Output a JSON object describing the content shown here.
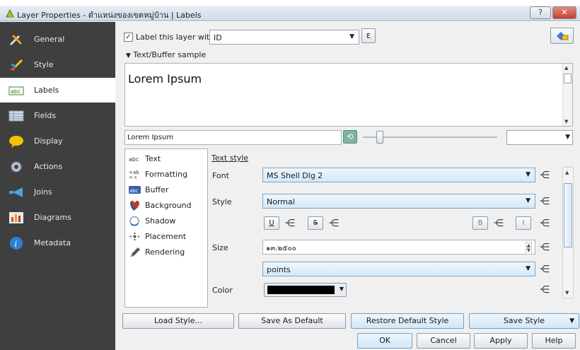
{
  "window": {
    "title": "Layer Properties - ตำแหน่งของเขตหมู่บ้าน | Labels",
    "help_label": "?",
    "close_label": "✕"
  },
  "sidebar": {
    "items": [
      {
        "label": "General",
        "icon": "tools-icon"
      },
      {
        "label": "Style",
        "icon": "paintbrush-icon"
      },
      {
        "label": "Labels",
        "icon": "abc-label-icon"
      },
      {
        "label": "Fields",
        "icon": "table-icon"
      },
      {
        "label": "Display",
        "icon": "speech-bubble-icon"
      },
      {
        "label": "Actions",
        "icon": "gear-icon"
      },
      {
        "label": "Joins",
        "icon": "join-arrow-icon"
      },
      {
        "label": "Diagrams",
        "icon": "diagram-icon"
      },
      {
        "label": "Metadata",
        "icon": "info-icon"
      }
    ],
    "active_index": 2
  },
  "labels_panel": {
    "label_with_text": "Label this layer with",
    "label_checked": true,
    "field_value": "ID",
    "expression_label": "ε",
    "sample_header": "Text/Buffer sample",
    "preview_text": "Lorem Ipsum",
    "sample_input_value": "Lorem Ipsum"
  },
  "tree": {
    "items": [
      {
        "label": "Text",
        "icon": "abc-text-icon"
      },
      {
        "label": "Formatting",
        "icon": "formatting-icon"
      },
      {
        "label": "Buffer",
        "icon": "abc-buffer-icon"
      },
      {
        "label": "Background",
        "icon": "heart-icon"
      },
      {
        "label": "Shadow",
        "icon": "shadow-icon"
      },
      {
        "label": "Placement",
        "icon": "placement-icon"
      },
      {
        "label": "Rendering",
        "icon": "pen-icon"
      }
    ]
  },
  "text_style": {
    "heading": "Text style",
    "font_label": "Font",
    "font_value": "MS Shell Dlg 2",
    "style_label": "Style",
    "style_value": "Normal",
    "underline_label": "U",
    "strike_label": "S",
    "bold_label": "B",
    "italic_label": "I",
    "size_label": "Size",
    "size_value": "๑๓.๒๕๐๐",
    "unit_value": "points",
    "color_label": "Color",
    "color_value": "#000000"
  },
  "buttons": {
    "load_style": "Load Style...",
    "save_default": "Save As Default",
    "restore_default": "Restore Default Style",
    "save_style": "Save Style",
    "ok": "OK",
    "cancel": "Cancel",
    "apply": "Apply",
    "help": "Help"
  }
}
